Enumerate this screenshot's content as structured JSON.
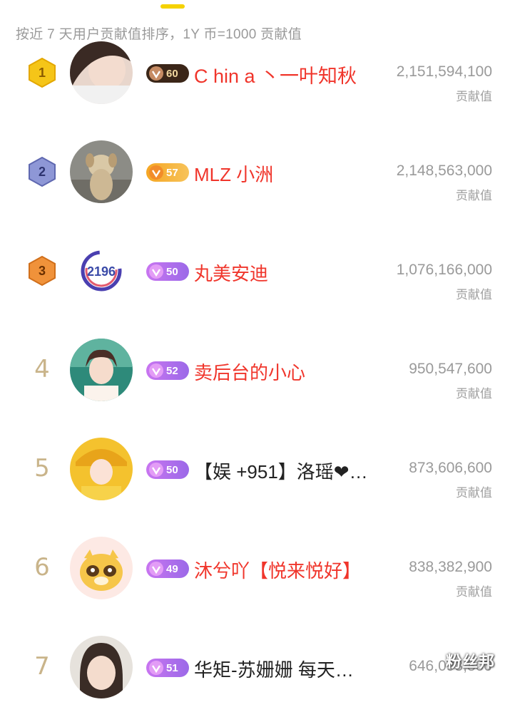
{
  "header": {
    "note": "按近 7 天用户贡献值排序，1Y 币=1000 贡献值"
  },
  "ranking": [
    {
      "rank": "1",
      "level": "60",
      "name": "C hin a 丶一叶知秋",
      "score": "2,151,594,100",
      "score_label": "贡献值",
      "name_color": "red",
      "badge_style": "dark"
    },
    {
      "rank": "2",
      "level": "57",
      "name": "MLZ 小洲",
      "score": "2,148,563,000",
      "score_label": "贡献值",
      "name_color": "red",
      "badge_style": "gold"
    },
    {
      "rank": "3",
      "level": "50",
      "name": "丸美安迪",
      "score": "1,076,166,000",
      "score_label": "贡献值",
      "name_color": "red",
      "badge_style": "purple"
    },
    {
      "rank": "4",
      "level": "52",
      "name": "卖后台的小心",
      "score": "950,547,600",
      "score_label": "贡献值",
      "name_color": "red",
      "badge_style": "purple"
    },
    {
      "rank": "5",
      "level": "50",
      "name": "【娱 +951】洛瑶❤…",
      "score": "873,606,600",
      "score_label": "贡献值",
      "name_color": "dark",
      "badge_style": "purple"
    },
    {
      "rank": "6",
      "level": "49",
      "name": "沐兮吖【悦来悦好】",
      "score": "838,382,900",
      "score_label": "贡献值",
      "name_color": "red",
      "badge_style": "purple"
    },
    {
      "rank": "7",
      "level": "51",
      "name": "华矩-苏姗姗 每天…",
      "score": "646,093,800",
      "score_label": "",
      "name_color": "dark",
      "badge_style": "purple"
    }
  ],
  "avatar3_text": "2196",
  "watermark": "粉丝邦",
  "colors": {
    "accent_yellow": "#f5d200",
    "name_red": "#f0352b",
    "rank_gold": "#f5c518",
    "rank_silver": "#7a84c8",
    "rank_bronze": "#f0923a",
    "rank_plain": "#c9b48a"
  }
}
